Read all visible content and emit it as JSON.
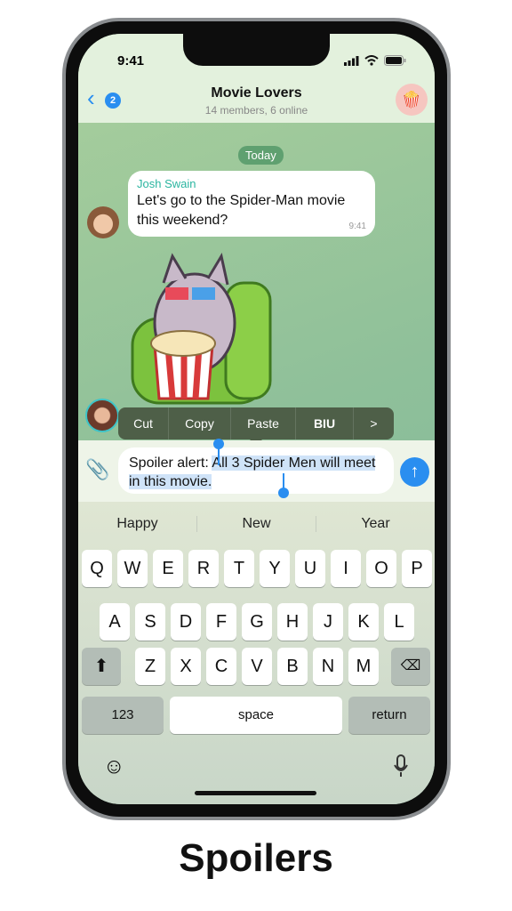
{
  "status": {
    "time": "9:41"
  },
  "header": {
    "title": "Movie Lovers",
    "subtitle": "14 members, 6 online",
    "unread_badge": "2"
  },
  "chat": {
    "date_chip": "Today",
    "message": {
      "sender": "Josh Swain",
      "text": "Let's go to the Spider-Man movie this weekend?",
      "time": "9:41"
    }
  },
  "context_menu": {
    "items": [
      "Cut",
      "Copy",
      "Paste",
      "BIU",
      ">"
    ]
  },
  "composer": {
    "text_before": "Spoiler alert: ",
    "text_selected": "All 3 Spider Men will meet in this movie."
  },
  "keyboard": {
    "suggestions": [
      "Happy",
      "New",
      "Year"
    ],
    "rows": [
      [
        "Q",
        "W",
        "E",
        "R",
        "T",
        "Y",
        "U",
        "I",
        "O",
        "P"
      ],
      [
        "A",
        "S",
        "D",
        "F",
        "G",
        "H",
        "J",
        "K",
        "L"
      ],
      [
        "Z",
        "X",
        "C",
        "V",
        "B",
        "N",
        "M"
      ]
    ],
    "numbers": "123",
    "space": "space",
    "return": "return"
  },
  "caption": "Spoilers",
  "colors": {
    "accent": "#2a8ef0",
    "sender": "#2bb5a0",
    "chat_bg": "#8fc09a"
  }
}
